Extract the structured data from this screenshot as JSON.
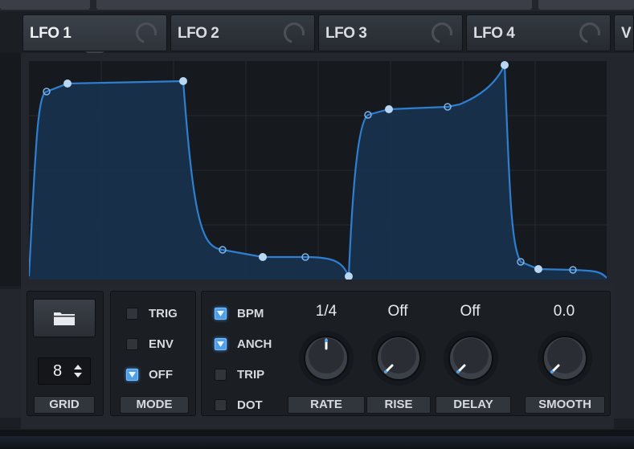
{
  "tabs": [
    {
      "label": "LFO 1",
      "active": true
    },
    {
      "label": "LFO 2",
      "active": false
    },
    {
      "label": "LFO 3",
      "active": false
    },
    {
      "label": "LFO 4",
      "active": false
    },
    {
      "label": "V",
      "active": false
    }
  ],
  "grid": {
    "value": "8",
    "label": "GRID"
  },
  "mode": {
    "label": "MODE",
    "options": [
      {
        "label": "TRIG",
        "checked": false
      },
      {
        "label": "ENV",
        "checked": false
      },
      {
        "label": "OFF",
        "checked": true
      }
    ]
  },
  "timing": {
    "options": [
      {
        "label": "BPM",
        "checked": true
      },
      {
        "label": "ANCH",
        "checked": true
      },
      {
        "label": "TRIP",
        "checked": false
      },
      {
        "label": "DOT",
        "checked": false
      }
    ]
  },
  "knobs": [
    {
      "label": "RATE",
      "value": "1/4",
      "position": 0.5
    },
    {
      "label": "RISE",
      "value": "Off",
      "position": 0.0
    },
    {
      "label": "DELAY",
      "value": "Off",
      "position": 0.0
    },
    {
      "label": "SMOOTH",
      "value": "0.0",
      "position": 0.0
    }
  ],
  "colors": {
    "accent": "#4ea6f0",
    "curve": "#2f7fd0",
    "fill": "#173450",
    "background": "#16191e"
  },
  "icons": {
    "folder": "folder-icon",
    "stepper": "stepper-arrows-icon",
    "check": "check-icon",
    "tab_indicator": "tab-ring-icon"
  }
}
